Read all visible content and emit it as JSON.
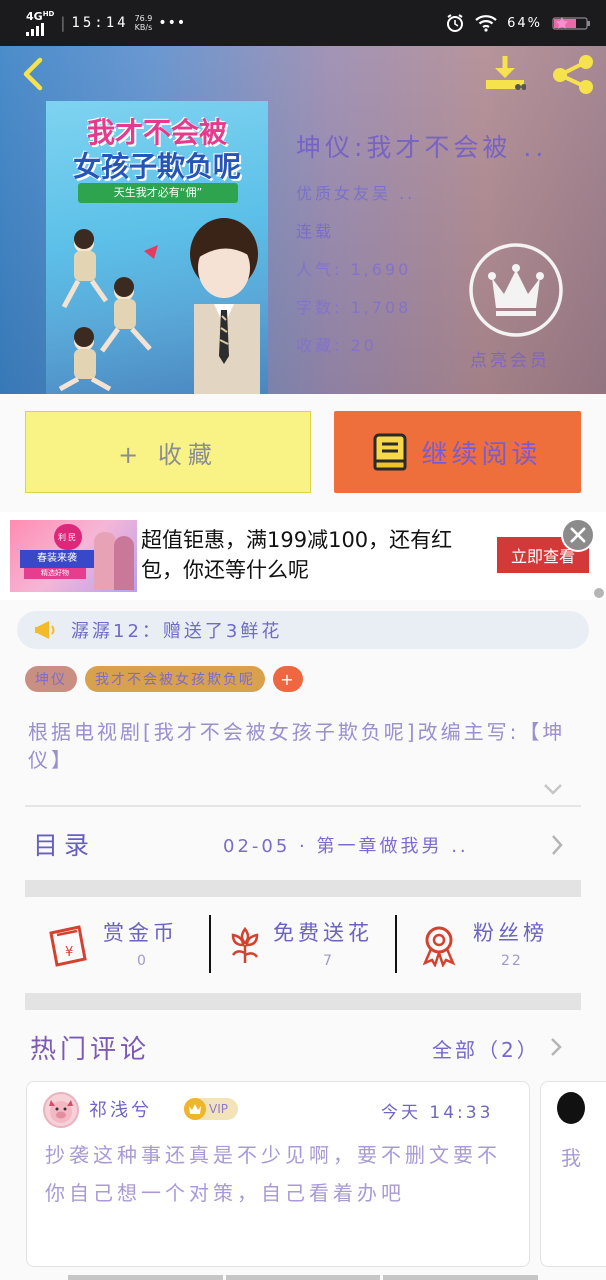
{
  "status_bar": {
    "network": "4G",
    "network_sub": "HD",
    "time": "15:14",
    "speed_value": "76.9",
    "speed_unit": "KB/s",
    "more": "•••",
    "battery": "64%"
  },
  "book": {
    "title": "坤仪:我才不会被 ..",
    "author": "优质女友吴 ..",
    "status": "连载",
    "popularity_label": "人气",
    "popularity": "1,690",
    "words_label": "字数",
    "words": "1,708",
    "favorites_label": "收藏",
    "favorites": "20",
    "cover": {
      "line1": "我才不会被",
      "line2": "女孩子欺负呢",
      "tagline": "天生我才必有“佣”"
    }
  },
  "vip": {
    "label": "点亮会员"
  },
  "buttons": {
    "favorite": "+ 收藏",
    "continue_reading": "继续阅读"
  },
  "ad": {
    "image_tag": "利民",
    "image_big": "春装来袭",
    "image_small": "精选好物",
    "text": "超值钜惠，满199减100，还有红包，你还等什么呢",
    "cta": "立即查看"
  },
  "gift_notice": "潺潺12：赠送了3鲜花",
  "tags": [
    "坤仪",
    "我才不会被女孩欺负呢",
    "+"
  ],
  "description": "根据电视剧[我才不会被女孩子欺负呢]改编主写:【坤仪】",
  "toc": {
    "title": "目录",
    "latest": "02-05 · 第一章做我男 .."
  },
  "actions": [
    {
      "label": "赏金币",
      "value": "0"
    },
    {
      "label": "免费送花",
      "value": "7"
    },
    {
      "label": "粉丝榜",
      "value": "22"
    }
  ],
  "comments": {
    "title": "热门评论",
    "all_label": "全部（2）",
    "items": [
      {
        "user": "祁浅兮",
        "badge": "VIP",
        "time": "今天 14:33",
        "text": "抄袭这种事还真是不少见啊，要不删文要不你自己想一个对策，自己看着办吧"
      },
      {
        "text": "我"
      }
    ]
  },
  "colors": {
    "header_gradient_start": "#3b83c6",
    "header_gradient_end": "#9e7d8a",
    "favorite_button": "#f9f386",
    "read_button": "#ee6e3c",
    "ad_cta": "#d4393a",
    "text_purple": "#7763c4"
  }
}
